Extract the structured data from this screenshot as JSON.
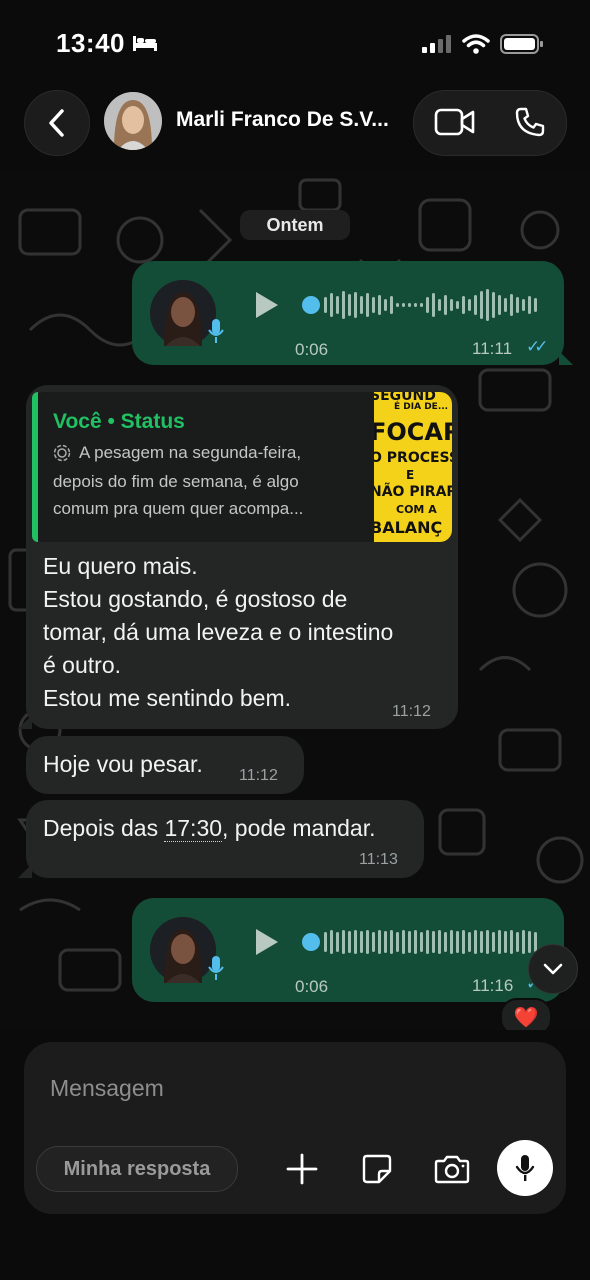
{
  "status_bar": {
    "time": "13:40"
  },
  "header": {
    "contact_name": "Marli Franco De S.V..."
  },
  "chat": {
    "date_separator": "Ontem",
    "messages": [
      {
        "type": "voice",
        "direction": "out",
        "duration": "0:06",
        "time": "11:11",
        "ticks": "✓✓"
      },
      {
        "type": "status_reply",
        "direction": "in",
        "quote_author": "Você • Status",
        "quote_lines": [
          "A pesagem na segunda-feira,",
          "depois do fim de semana, é algo",
          "comum pra quem quer acompa..."
        ],
        "thumbnail_lines": [
          "SEGUND",
          "É DIA DE...",
          "FOCAR",
          "O PROCESS",
          "E",
          "NÃO PIRAR",
          "COM A",
          "BALANÇ"
        ],
        "text_lines": [
          "Eu quero mais.",
          "Estou gostando, é gostoso de",
          "tomar, dá uma leveza e o intestino",
          "é outro.",
          "Estou me sentindo bem."
        ],
        "time": "11:12"
      },
      {
        "type": "text",
        "direction": "in",
        "text": "Hoje vou pesar.",
        "time": "11:12"
      },
      {
        "type": "text",
        "direction": "in",
        "text_before": "Depois das ",
        "link": "17:30",
        "text_after": ", pode mandar.",
        "time": "11:13"
      },
      {
        "type": "voice",
        "direction": "out",
        "duration": "0:06",
        "time": "11:16",
        "ticks": "✓✓",
        "reaction": "❤️"
      }
    ]
  },
  "composer": {
    "placeholder": "Mensagem",
    "chip_label": "Minha resposta"
  },
  "colors": {
    "outgoing_bubble": "#144d37",
    "incoming_bubble": "#242626",
    "accent_green": "#21c063",
    "read_ticks": "#53bdeb"
  },
  "icons": [
    "back-icon",
    "video-call-icon",
    "phone-icon",
    "play-icon",
    "mic-icon",
    "plus-icon",
    "sticker-icon",
    "camera-icon",
    "chevron-down-icon",
    "heart-icon",
    "status-ring-icon"
  ]
}
